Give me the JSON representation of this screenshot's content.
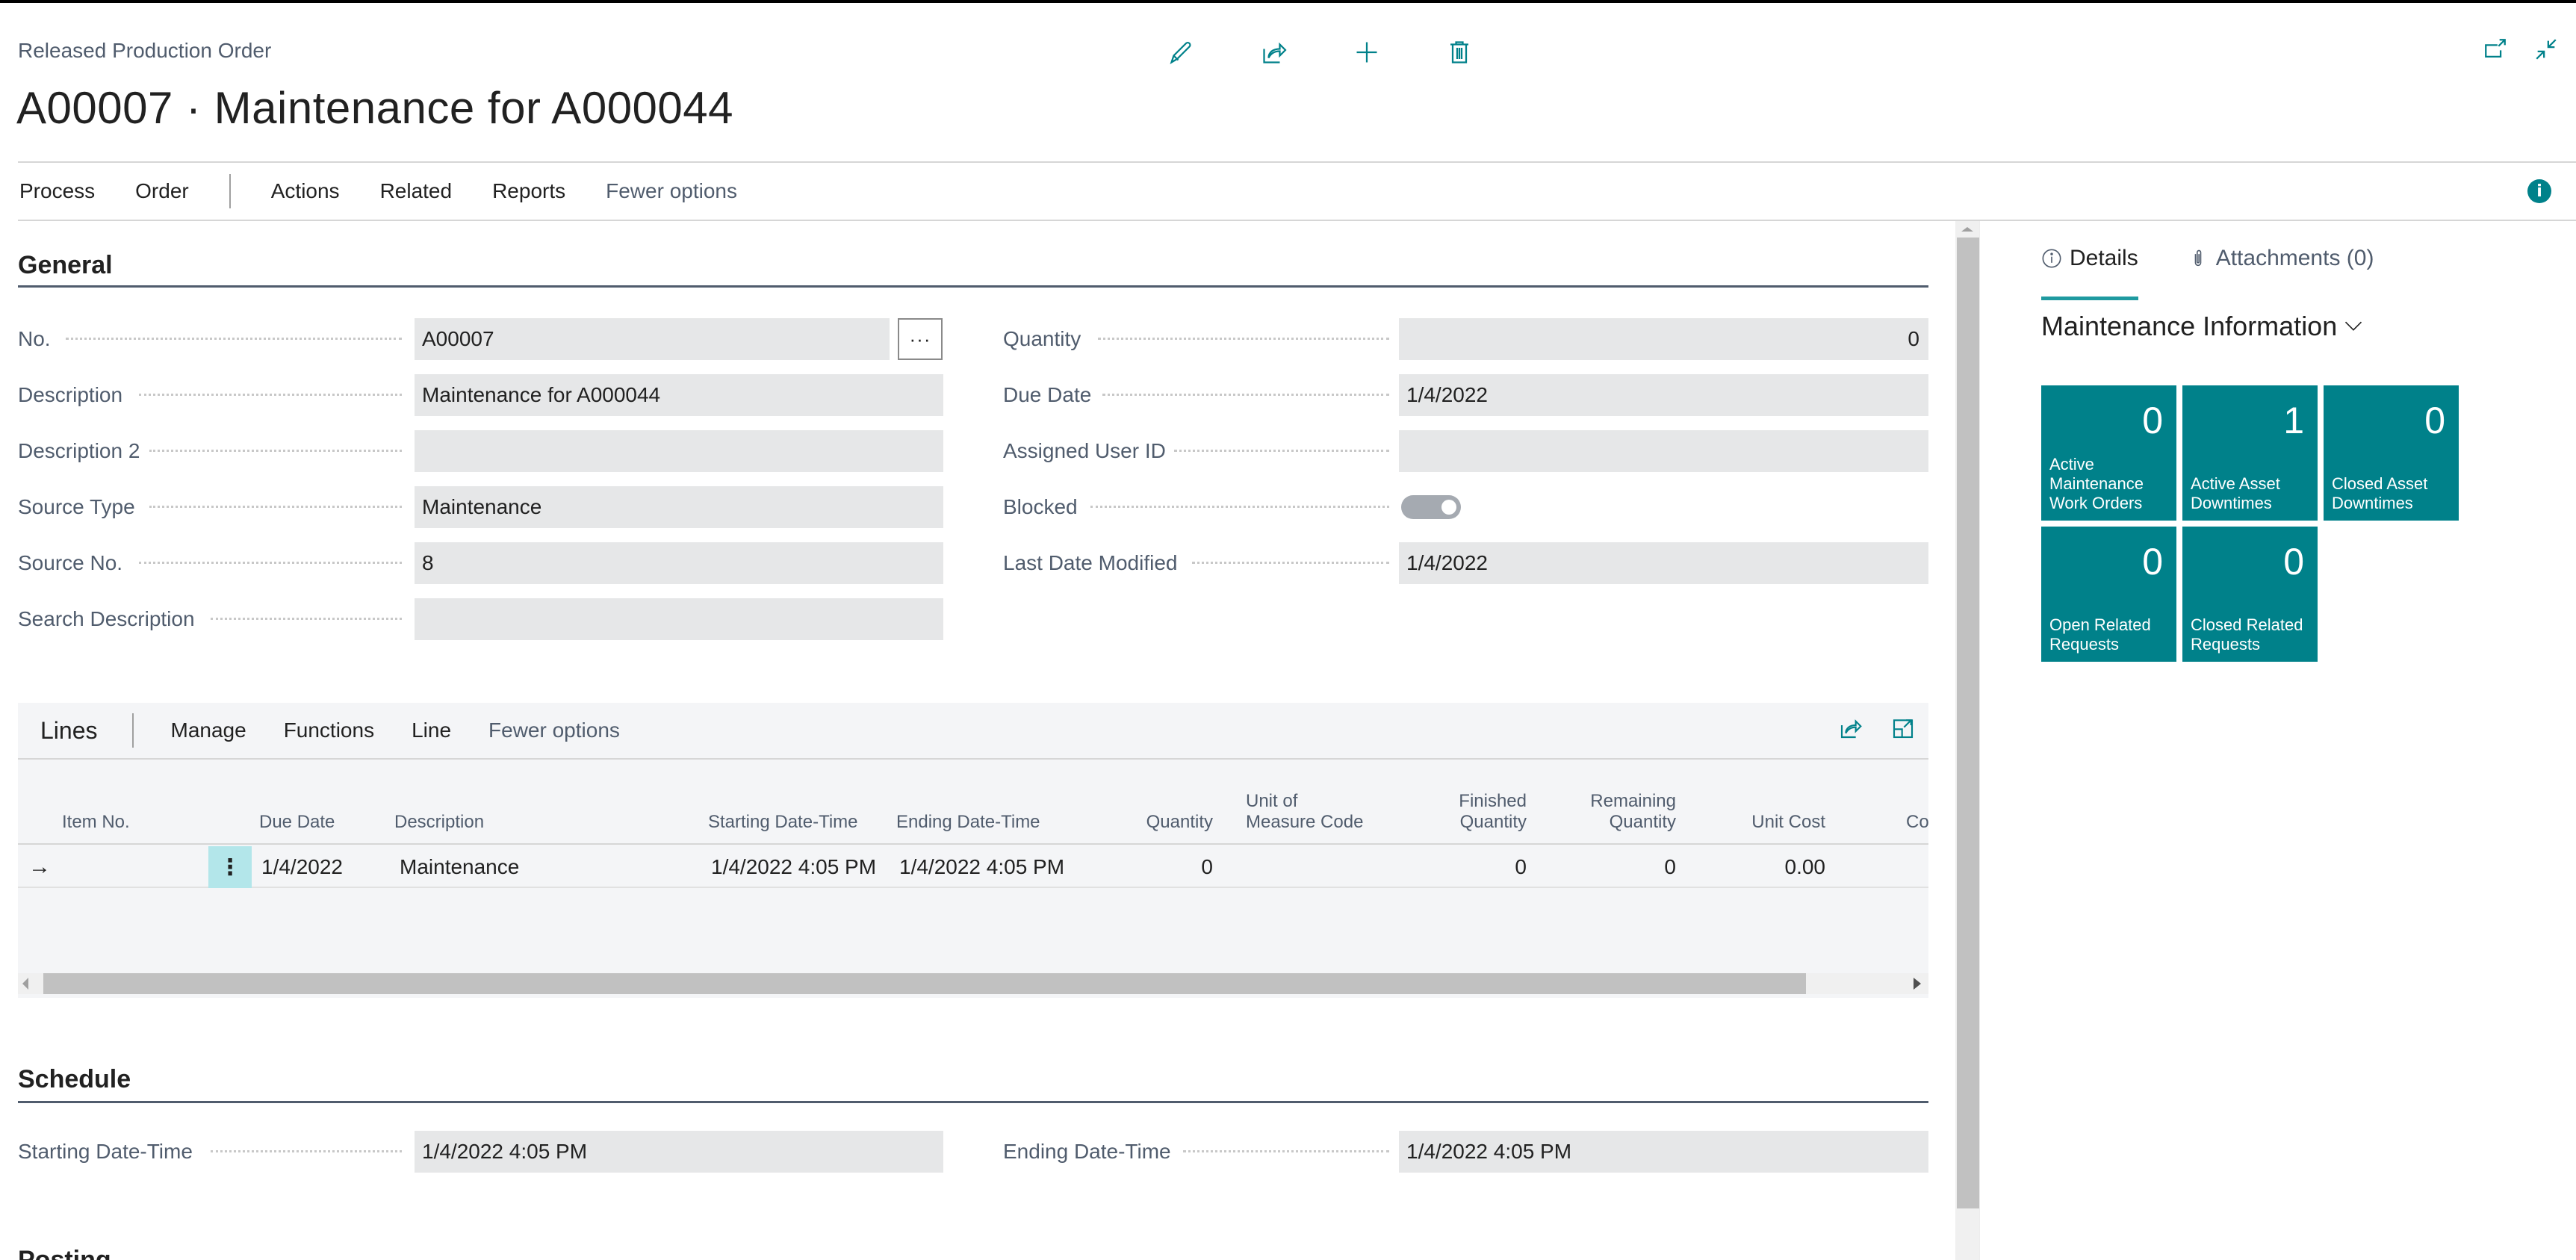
{
  "header": {
    "subtitle": "Released Production Order",
    "title": "A00007 · Maintenance for A000044",
    "icons": [
      "edit-icon",
      "share-icon",
      "new-icon",
      "delete-icon"
    ],
    "right_icons": [
      "open-new-window-icon",
      "collapse-icon"
    ]
  },
  "actionbar": {
    "items": [
      "Process",
      "Order",
      "Actions",
      "Related",
      "Reports",
      "Fewer options"
    ]
  },
  "general": {
    "title": "General",
    "left_fields": [
      {
        "label": "No.",
        "value": "A00007"
      },
      {
        "label": "Description",
        "value": "Maintenance for A000044"
      },
      {
        "label": "Description 2",
        "value": ""
      },
      {
        "label": "Source Type",
        "value": "Maintenance"
      },
      {
        "label": "Source No.",
        "value": "8"
      },
      {
        "label": "Search Description",
        "value": ""
      }
    ],
    "right_fields": [
      {
        "label": "Quantity",
        "value": "0"
      },
      {
        "label": "Due Date",
        "value": "1/4/2022"
      },
      {
        "label": "Assigned User ID",
        "value": ""
      },
      {
        "label": "Blocked",
        "value": "off"
      },
      {
        "label": "Last Date Modified",
        "value": "1/4/2022"
      }
    ],
    "lookup_label": "···"
  },
  "lines": {
    "title": "Lines",
    "actions": [
      "Manage",
      "Functions",
      "Line",
      "Fewer options"
    ],
    "columns": {
      "item_no": "Item No.",
      "due_date": "Due Date",
      "description": "Description",
      "starting": "Starting Date-Time",
      "ending": "Ending Date-Time",
      "quantity": "Quantity",
      "uom_1": "Unit of",
      "uom_2": "Measure Code",
      "finished_1": "Finished",
      "finished_2": "Quantity",
      "remaining_1": "Remaining",
      "remaining_2": "Quantity",
      "unit_cost": "Unit Cost",
      "cost_partial": "Co"
    },
    "rows": [
      {
        "arrow": "→",
        "menu": "⋮",
        "item_no": "",
        "due_date": "1/4/2022",
        "description": "Maintenance",
        "starting": "1/4/2022 4:05 PM",
        "ending": "1/4/2022 4:05 PM",
        "quantity": "0",
        "uom": "",
        "finished": "0",
        "remaining": "0",
        "unit_cost": "0.00"
      }
    ]
  },
  "schedule": {
    "title": "Schedule",
    "left_field": {
      "label": "Starting Date-Time",
      "value": "1/4/2022 4:05 PM"
    },
    "right_field": {
      "label": "Ending Date-Time",
      "value": "1/4/2022 4:05 PM"
    }
  },
  "next_section_title": "Posting",
  "factbox": {
    "tabs": [
      {
        "label": "Details",
        "icon": "info-icon",
        "active": true
      },
      {
        "label": "Attachments (0)",
        "icon": "paperclip-icon",
        "active": false
      }
    ],
    "title": "Maintenance Information",
    "tiles": [
      {
        "value": "0",
        "label": "Active Maintenance Work Orders"
      },
      {
        "value": "1",
        "label": "Active Asset Downtimes"
      },
      {
        "value": "0",
        "label": "Closed Asset Downtimes"
      },
      {
        "value": "0",
        "label": "Open Related Requests"
      },
      {
        "value": "0",
        "label": "Closed Related Requests"
      }
    ]
  },
  "colors": {
    "accent": "#00818a",
    "tile": "#00818a",
    "field_bg": "#e6e7e8",
    "label": "#505c6d"
  }
}
